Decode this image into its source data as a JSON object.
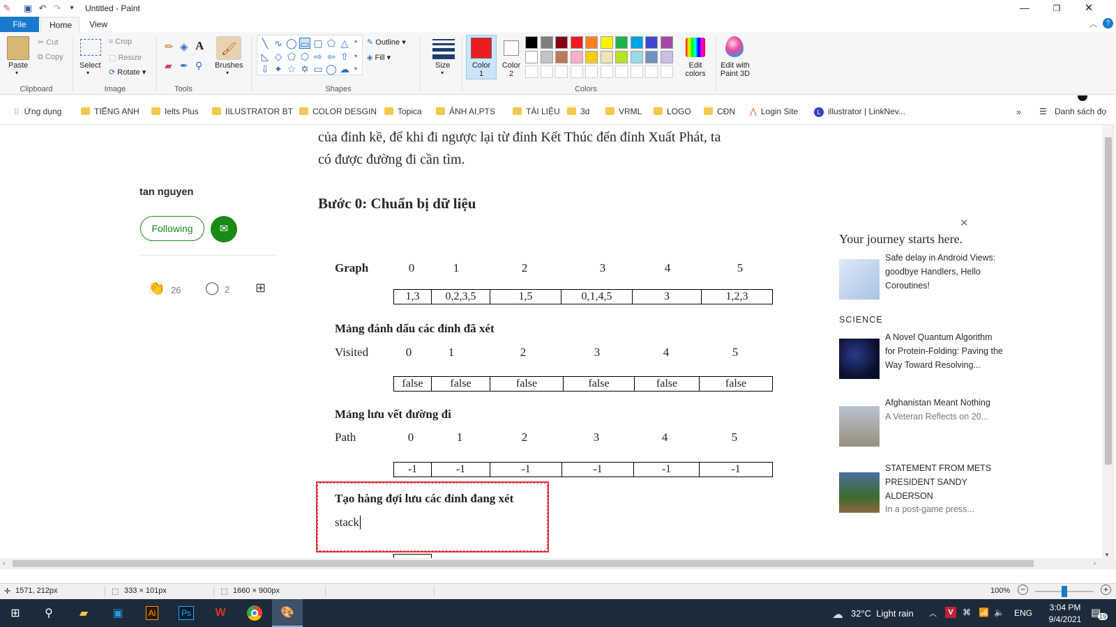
{
  "window": {
    "title": "Untitled - Paint"
  },
  "ribbon_tabs": [
    "File",
    "Home",
    "View"
  ],
  "clipboard": {
    "paste": "Paste",
    "cut": "Cut",
    "copy": "Copy",
    "label": "Clipboard"
  },
  "image": {
    "select": "Select",
    "crop": "Crop",
    "resize": "Resize",
    "rotate": "Rotate",
    "label": "Image"
  },
  "tools": {
    "label": "Tools",
    "brushes": "Brushes"
  },
  "shapes": {
    "label": "Shapes",
    "outline": "Outline",
    "fill": "Fill"
  },
  "size": {
    "label": "Size"
  },
  "colors": {
    "color1": "Color",
    "color1_num": "1",
    "color2": "Color",
    "color2_num": "2",
    "label": "Colors",
    "edit": "Edit",
    "edit2": "colors",
    "paint3d": "Edit with",
    "paint3d2": "Paint 3D",
    "color1_value": "#ed1c24",
    "color2_value": "#ffffff",
    "palette_row1": [
      "#000000",
      "#7f7f7f",
      "#880015",
      "#ed1c24",
      "#ff7f27",
      "#fff200",
      "#22b14c",
      "#00a2e8",
      "#3f48cc",
      "#a349a4"
    ],
    "palette_row2": [
      "#ffffff",
      "#c3c3c3",
      "#b97a57",
      "#ffaec9",
      "#ffc90e",
      "#efe4b0",
      "#b5e61d",
      "#99d9ea",
      "#7092be",
      "#c8bfe7"
    ]
  },
  "bookmarks": [
    "Ứng dụng",
    "TIẾNG ANH",
    "Ielts Plus",
    "IILUSTRATOR BT",
    "COLOR DESGIN",
    "Topica",
    "ẢNH AI,PTS",
    "TÀI LIỆU",
    "3d",
    "VRML",
    "LOGO",
    "CĐN",
    "Login Site",
    "illustrator | LinkNev...",
    "Danh sách đọ"
  ],
  "article": {
    "line1": "của đỉnh kề, để khi đi ngược lại từ đỉnh Kết Thúc đến đỉnh Xuất Phát, ta",
    "line2": "có được đường đi cần tìm.",
    "heading": "Bước 0: Chuẩn bị dữ liệu"
  },
  "author": {
    "name": "tan nguyen",
    "following": "Following",
    "claps": "26",
    "comments": "2"
  },
  "graph": {
    "title": "Graph",
    "indices": [
      "0",
      "1",
      "2",
      "3",
      "4",
      "5"
    ],
    "values": [
      "1,3",
      "0,2,3,5",
      "1,5",
      "0,1,4,5",
      "3",
      "1,2,3"
    ]
  },
  "visited": {
    "title": "Mảng đánh dấu các đỉnh đã xét",
    "label": "Visited",
    "indices": [
      "0",
      "1",
      "2",
      "3",
      "4",
      "5"
    ],
    "values": [
      "false",
      "false",
      "false",
      "false",
      "false",
      "false"
    ]
  },
  "path": {
    "title": "Mảng lưu vết đường đi",
    "label": "Path",
    "indices": [
      "0",
      "1",
      "2",
      "3",
      "4",
      "5"
    ],
    "values": [
      "-1",
      "-1",
      "-1",
      "-1",
      "-1",
      "-1"
    ]
  },
  "queue": {
    "title": "Tạo hàng đợi lưu các đỉnh đang xét",
    "label": "stack",
    "cell": "..."
  },
  "sidebar": {
    "heading": "Your journey starts here.",
    "item1": "Safe delay in Android Views: goodbye Handlers, Hello Coroutines!",
    "section": "SCIENCE",
    "item2": "A Novel Quantum Algorithm for Protein-Folding: Paving the Way Toward Resolving...",
    "item3_title": "Afghanistan Meant Nothing",
    "item3_sub": "A Veteran Reflects on 20...",
    "item4_title": "STATEMENT FROM METS PRESIDENT SANDY ALDERSON",
    "item4_sub": "In a post-game press..."
  },
  "status": {
    "cursor": "1571, 212px",
    "selection": "333 × 101px",
    "canvas": "1660 × 900px",
    "zoom": "100%"
  },
  "taskbar": {
    "weather": "32°C  Light rain",
    "lang": "ENG",
    "time": "3:04 PM",
    "date": "9/4/2021",
    "notif": "19"
  }
}
